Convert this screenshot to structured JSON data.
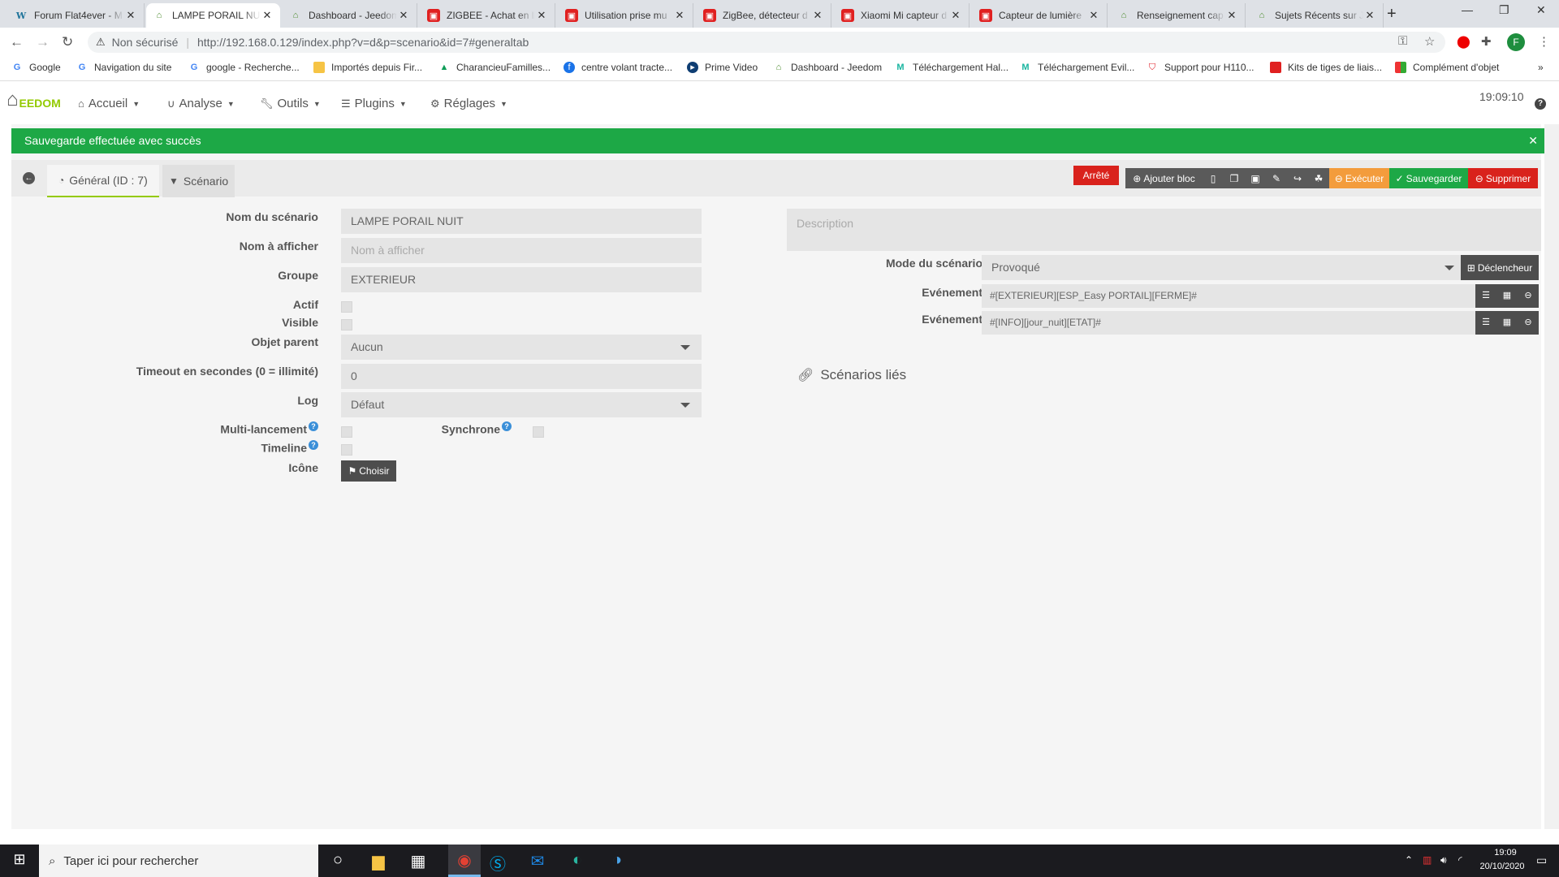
{
  "browser": {
    "tabs": [
      {
        "title": "Forum Flat4ever - M",
        "icon": "wordpress-icon"
      },
      {
        "title": "LAMPE PORAIL NUIT",
        "icon": "jeedom-icon",
        "active": true
      },
      {
        "title": "Dashboard - Jeedom",
        "icon": "jeedom-icon"
      },
      {
        "title": "ZIGBEE - Achat en li",
        "icon": "red-shop-icon"
      },
      {
        "title": "Utilisation prise mu",
        "icon": "red-shop-icon"
      },
      {
        "title": "ZigBee, détecteur d",
        "icon": "red-shop-icon"
      },
      {
        "title": "Xiaomi Mi capteur d",
        "icon": "red-shop-icon"
      },
      {
        "title": "Capteur de lumière",
        "icon": "red-shop-icon"
      },
      {
        "title": "Renseignement cap",
        "icon": "jeedom-icon"
      },
      {
        "title": "Sujets Récents sur J",
        "icon": "jeedom-icon"
      }
    ],
    "address": {
      "security": "Non sécurisé",
      "url": "http://192.168.0.129/index.php?v=d&p=scenario&id=7#generaltab"
    },
    "profile_initial": "F",
    "bookmarks": [
      "Google",
      "Navigation du site",
      "google - Recherche...",
      "Importés depuis Fir...",
      "CharancieuFamilles...",
      "centre volant tracte...",
      "Prime Video",
      "Dashboard - Jeedom",
      "Téléchargement Hal...",
      "Téléchargement Evil...",
      "Support pour H110...",
      "Kits de tiges de liais...",
      "Complément d'objet"
    ]
  },
  "jeedom": {
    "logo": "EEDOM",
    "menu": [
      "Accueil",
      "Analyse",
      "Outils",
      "Plugins",
      "Réglages"
    ],
    "clock": "19:09:10",
    "alert": "Sauvegarde effectuée avec succès",
    "tabs": {
      "general": "Général (ID : 7)",
      "scenario": "Scénario"
    },
    "toolbar": {
      "status": "Arrêté",
      "add_block": "Ajouter bloc",
      "execute": "Exécuter",
      "save": "Sauvegarder",
      "delete": "Supprimer"
    },
    "form": {
      "name_label": "Nom du scénario",
      "name_value": "LAMPE PORAIL NUIT",
      "display_label": "Nom à afficher",
      "display_placeholder": "Nom à afficher",
      "group_label": "Groupe",
      "group_value": "EXTERIEUR",
      "active_label": "Actif",
      "visible_label": "Visible",
      "parent_label": "Objet parent",
      "parent_value": "Aucun",
      "timeout_label": "Timeout en secondes (0 = illimité)",
      "timeout_value": "0",
      "log_label": "Log",
      "log_value": "Défaut",
      "multi_label": "Multi-lancement",
      "sync_label": "Synchrone",
      "timeline_label": "Timeline",
      "icon_label": "Icône",
      "choose_label": "Choisir"
    },
    "right": {
      "description_placeholder": "Description",
      "mode_label": "Mode du scénario",
      "mode_value": "Provoqué",
      "trigger_button": "Déclencheur",
      "events": [
        {
          "label": "Evénement",
          "value": "#[EXTERIEUR][ESP_Easy PORTAIL][FERME]#"
        },
        {
          "label": "Evénement",
          "value": "#[INFO][jour_nuit][ETAT]#"
        }
      ],
      "linked_title": "Scénarios liés"
    }
  },
  "taskbar": {
    "search_placeholder": "Taper ici pour rechercher",
    "time": "19:09",
    "date": "20/10/2020"
  },
  "colors": {
    "success": "#1da846",
    "danger": "#d9221c",
    "warning": "#f39c3c",
    "accent": "#94ca02"
  }
}
